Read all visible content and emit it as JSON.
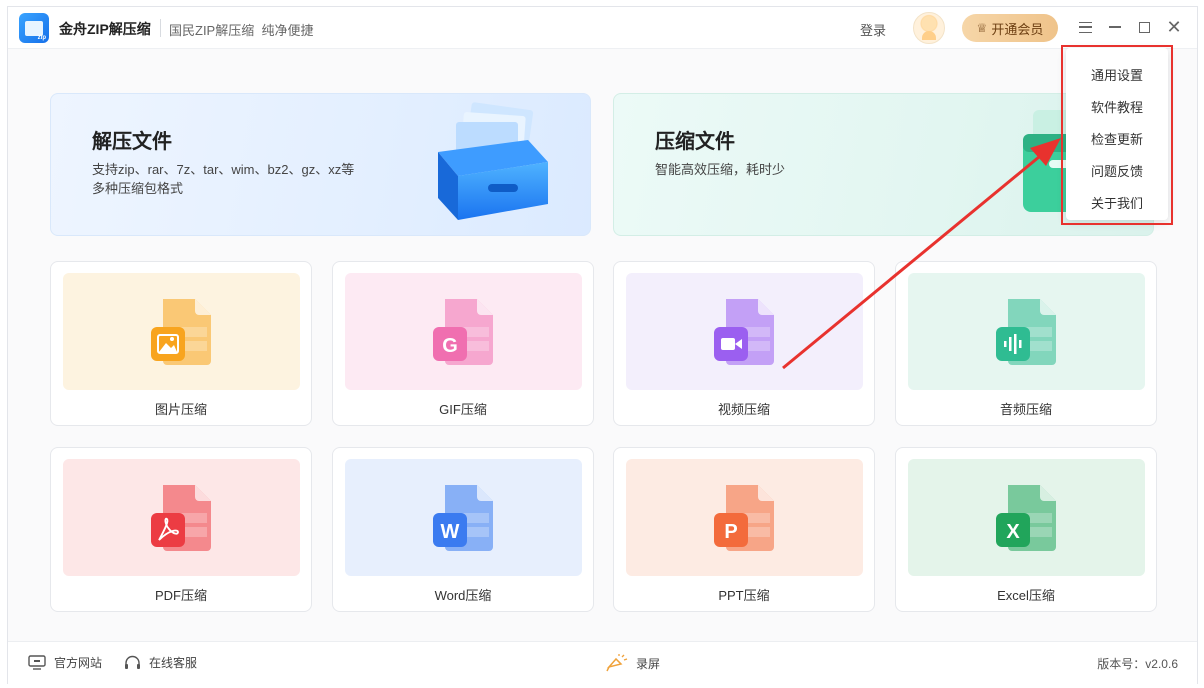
{
  "app": {
    "name": "金舟ZIP解压缩",
    "slogan": "国民ZIP解压缩  纯净便捷"
  },
  "titlebar": {
    "login": "登录",
    "vip": "开通会员",
    "icons": [
      "menu-icon",
      "minimize-icon",
      "maximize-icon",
      "close-icon"
    ]
  },
  "hero": {
    "extract": {
      "title": "解压文件",
      "desc_line1": "支持zip、rar、7z、tar、wim、bz2、gz、xz等",
      "desc_line2": "多种压缩包格式"
    },
    "compress": {
      "title": "压缩文件",
      "desc_line1": "智能高效压缩，耗时少"
    }
  },
  "tools": [
    {
      "label": "图片压缩",
      "icon": "image-file-icon",
      "color": "#f8a41e",
      "bg": "#fdf3e0",
      "glyph": ""
    },
    {
      "label": "GIF压缩",
      "icon": "gif-file-icon",
      "color": "#f06fb0",
      "bg": "#fdeaf3",
      "glyph": "G"
    },
    {
      "label": "视频压缩",
      "icon": "video-file-icon",
      "color": "#9b5ff0",
      "bg": "#f3effc",
      "glyph": ""
    },
    {
      "label": "音频压缩",
      "icon": "audio-file-icon",
      "color": "#2fbc92",
      "bg": "#e6f6f0",
      "glyph": ""
    },
    {
      "label": "PDF压缩",
      "icon": "pdf-file-icon",
      "color": "#ec3c43",
      "bg": "#fde7e7",
      "glyph": ""
    },
    {
      "label": "Word压缩",
      "icon": "word-file-icon",
      "color": "#3b7bf0",
      "bg": "#e7effd",
      "glyph": "W"
    },
    {
      "label": "PPT压缩",
      "icon": "ppt-file-icon",
      "color": "#f36b3c",
      "bg": "#fdebe3",
      "glyph": "P"
    },
    {
      "label": "Excel压缩",
      "icon": "excel-file-icon",
      "color": "#21a55b",
      "bg": "#e4f4ea",
      "glyph": "X"
    }
  ],
  "dropdown": {
    "items": [
      "通用设置",
      "软件教程",
      "检查更新",
      "问题反馈",
      "关于我们"
    ]
  },
  "footer": {
    "website": "官方网站",
    "service": "在线客服",
    "record": "录屏",
    "version": "版本号：v2.0.6"
  },
  "colors": {
    "highlight": "#e8322e",
    "vip_bg": "#efc38a"
  }
}
